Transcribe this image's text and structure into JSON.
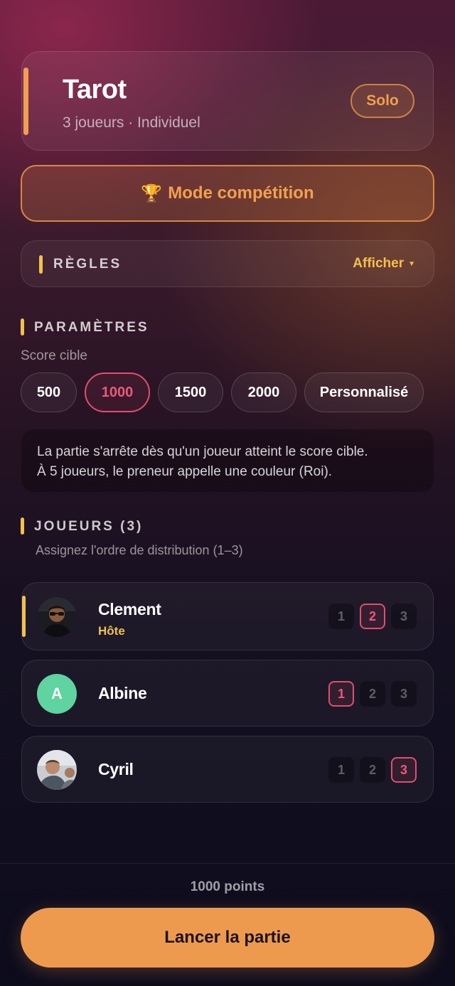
{
  "game": {
    "title": "Tarot",
    "subtitle": "3 joueurs · Individuel",
    "mode_badge": "Solo"
  },
  "competition": {
    "icon": "trophy-icon",
    "label": "Mode compétition"
  },
  "rules": {
    "label": "RÈGLES",
    "toggle": "Afficher",
    "toggle_icon": "caret-down-icon"
  },
  "parameters": {
    "title": "PARAMÈTRES",
    "target_label": "Score cible",
    "options": [
      "500",
      "1000",
      "1500",
      "2000",
      "Personnalisé"
    ],
    "selected": "1000",
    "info_line1": "La partie s'arrête dès qu'un joueur atteint le score cible.",
    "info_line2": "À 5 joueurs, le preneur appelle une couleur (Roi)."
  },
  "players": {
    "title": "JOUEURS (3)",
    "subtitle": "Assignez l'ordre de distribution (1–3)",
    "order_numbers": [
      "1",
      "2",
      "3"
    ],
    "list": [
      {
        "name": "Clement",
        "role": "Hôte",
        "avatar": "photo",
        "order": 2
      },
      {
        "name": "Albine",
        "avatar_letter": "A",
        "avatar": "letter",
        "order": 1
      },
      {
        "name": "Cyril",
        "avatar": "photo",
        "order": 3
      }
    ]
  },
  "footer": {
    "points": "1000 points",
    "launch_label": "Lancer la partie"
  },
  "colors": {
    "accent_orange": "#ee9a4e",
    "accent_yellow": "#f2c14a",
    "selected_pink": "#e14e6e",
    "avatar_green": "#5fd3a0"
  }
}
